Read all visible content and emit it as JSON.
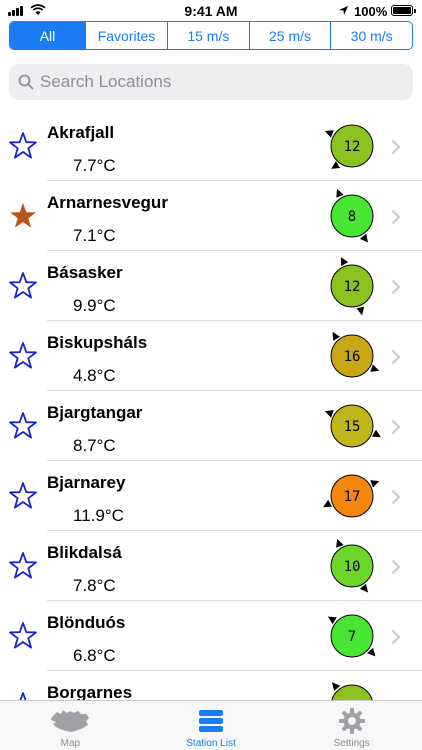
{
  "status_bar": {
    "time": "9:41 AM",
    "battery": "100%"
  },
  "filters": [
    {
      "label": "All",
      "active": true
    },
    {
      "label": "Favorites",
      "active": false
    },
    {
      "label": "15 m/s",
      "active": false
    },
    {
      "label": "25 m/s",
      "active": false
    },
    {
      "label": "30 m/s",
      "active": false
    }
  ],
  "search": {
    "placeholder": "Search Locations"
  },
  "stations": [
    {
      "name": "Akrafjall",
      "temp": "7.7°C",
      "wind": "12",
      "color": "#8cc21f",
      "favorite": false
    },
    {
      "name": "Arnarnesvegur",
      "temp": "7.1°C",
      "wind": "8",
      "color": "#46e632",
      "favorite": true
    },
    {
      "name": "Básasker",
      "temp": "9.9°C",
      "wind": "12",
      "color": "#8cc21f",
      "favorite": false
    },
    {
      "name": "Biskupsháls",
      "temp": "4.8°C",
      "wind": "16",
      "color": "#c9a716",
      "favorite": false
    },
    {
      "name": "Bjargtangar",
      "temp": "8.7°C",
      "wind": "15",
      "color": "#c0b51a",
      "favorite": false
    },
    {
      "name": "Bjarnarey",
      "temp": "11.9°C",
      "wind": "17",
      "color": "#f5870e",
      "favorite": false
    },
    {
      "name": "Blikdalsá",
      "temp": "7.8°C",
      "wind": "10",
      "color": "#6ed62a",
      "favorite": false
    },
    {
      "name": "Blönduós",
      "temp": "6.8°C",
      "wind": "7",
      "color": "#46e632",
      "favorite": false
    },
    {
      "name": "Borgarnes",
      "temp": "",
      "wind": "",
      "color": "#8cc21f",
      "favorite": false
    }
  ],
  "tabs": [
    {
      "label": "Map",
      "icon": "iceland-map-icon",
      "active": false
    },
    {
      "label": "Station List",
      "icon": "list-icon",
      "active": true
    },
    {
      "label": "Settings",
      "icon": "gear-icon",
      "active": false
    }
  ],
  "colors": {
    "accent": "#1a7cf5",
    "star_outline": "#1a24c8",
    "star_favorite": "#b8531a"
  }
}
